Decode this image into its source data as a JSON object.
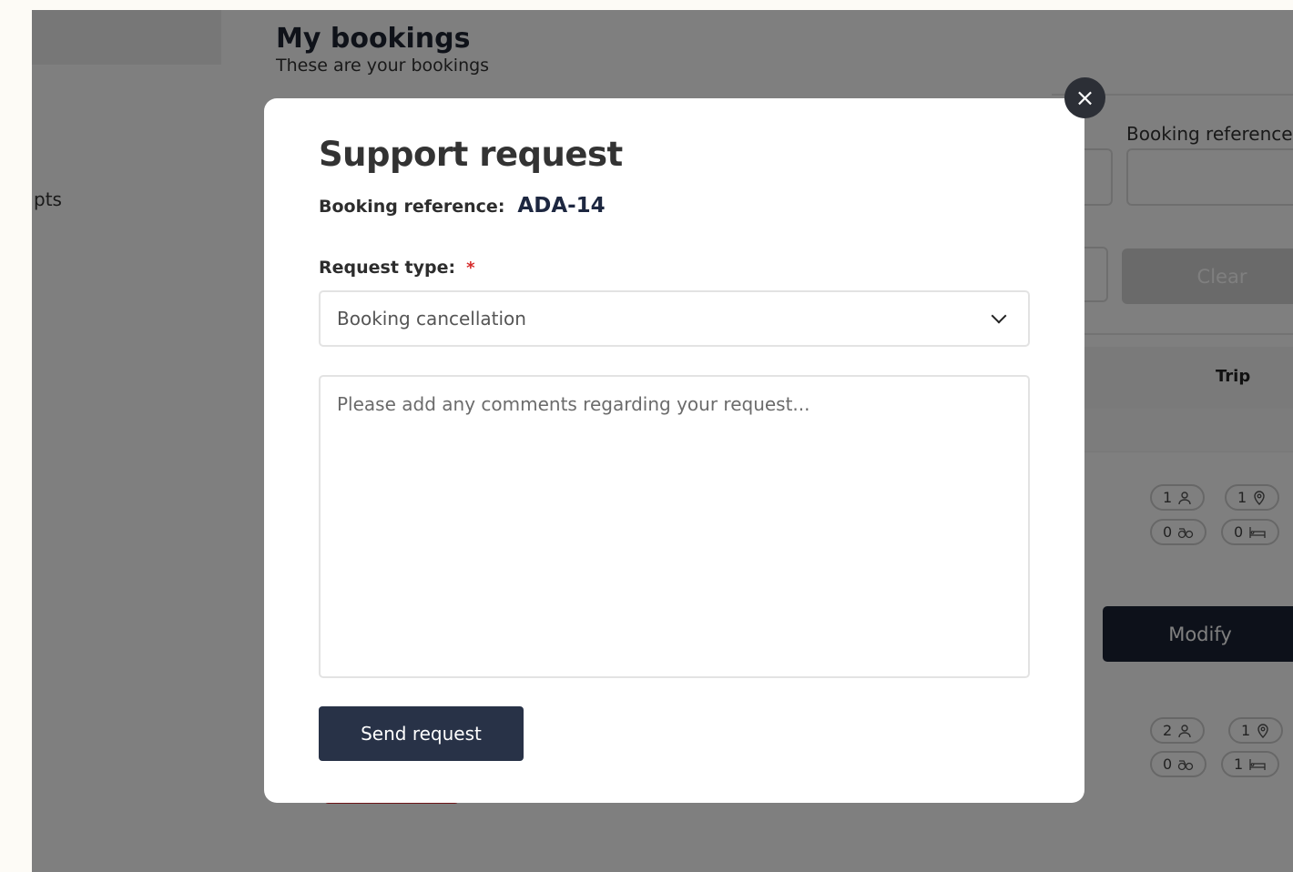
{
  "background": {
    "page_title": "My bookings",
    "page_subtitle": "These are your bookings",
    "sidebar_item": "pts",
    "filter_label": "Booking reference",
    "clear_label": "Clear",
    "trip_header": "Trip",
    "modify_label": "Modify",
    "trip_rows": [
      {
        "passengers": "1",
        "stops": "1",
        "accessibility": "0",
        "beds": "0"
      },
      {
        "passengers": "2",
        "stops": "1",
        "accessibility": "0",
        "beds": "1"
      }
    ]
  },
  "modal": {
    "title": "Support request",
    "reference_label": "Booking reference:",
    "reference_value": "ADA-14",
    "request_type_label": "Request type:",
    "required_marker": "*",
    "request_type_selected": "Booking cancellation",
    "comments_placeholder": "Please add any comments regarding your request...",
    "send_label": "Send request",
    "close_icon": "×"
  }
}
